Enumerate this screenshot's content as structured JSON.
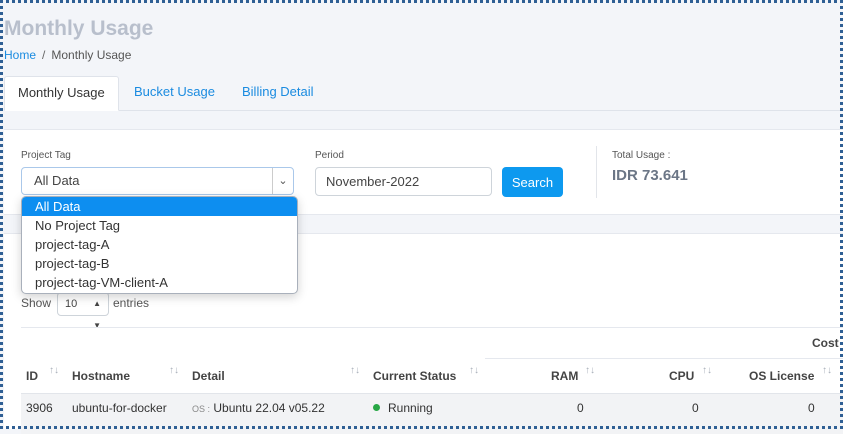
{
  "page": {
    "title": "Monthly Usage"
  },
  "breadcrumb": {
    "home": "Home",
    "separator": "/",
    "current": "Monthly Usage"
  },
  "tabs": [
    {
      "label": "Monthly Usage",
      "active": true
    },
    {
      "label": "Bucket Usage",
      "active": false
    },
    {
      "label": "Billing Detail",
      "active": false
    }
  ],
  "filters": {
    "project_tag": {
      "label": "Project Tag",
      "value": "All Data",
      "options": [
        "All Data",
        "No Project Tag",
        "project-tag-A",
        "project-tag-B",
        "project-tag-VM-client-A"
      ]
    },
    "period": {
      "label": "Period",
      "value": "November-2022"
    },
    "search_label": "Search",
    "total": {
      "label": "Total Usage :",
      "value": "IDR 73.641"
    }
  },
  "table": {
    "show_label": "Show",
    "entries_value": "10",
    "entries_label": "entries",
    "cost_header": "Cost",
    "columns": [
      "ID",
      "Hostname",
      "Detail",
      "Current Status",
      "RAM",
      "CPU",
      "OS License"
    ],
    "rows": [
      {
        "id": "3906",
        "hostname": "ubuntu-for-docker",
        "detail_prefix": "OS :",
        "detail": "Ubuntu 22.04 v05.22",
        "status": "Running",
        "ram": "0",
        "cpu": "0",
        "os_license": "0"
      }
    ]
  },
  "colors": {
    "accent": "#0d99ef",
    "link": "#1a8be0",
    "running": "#28a745"
  }
}
